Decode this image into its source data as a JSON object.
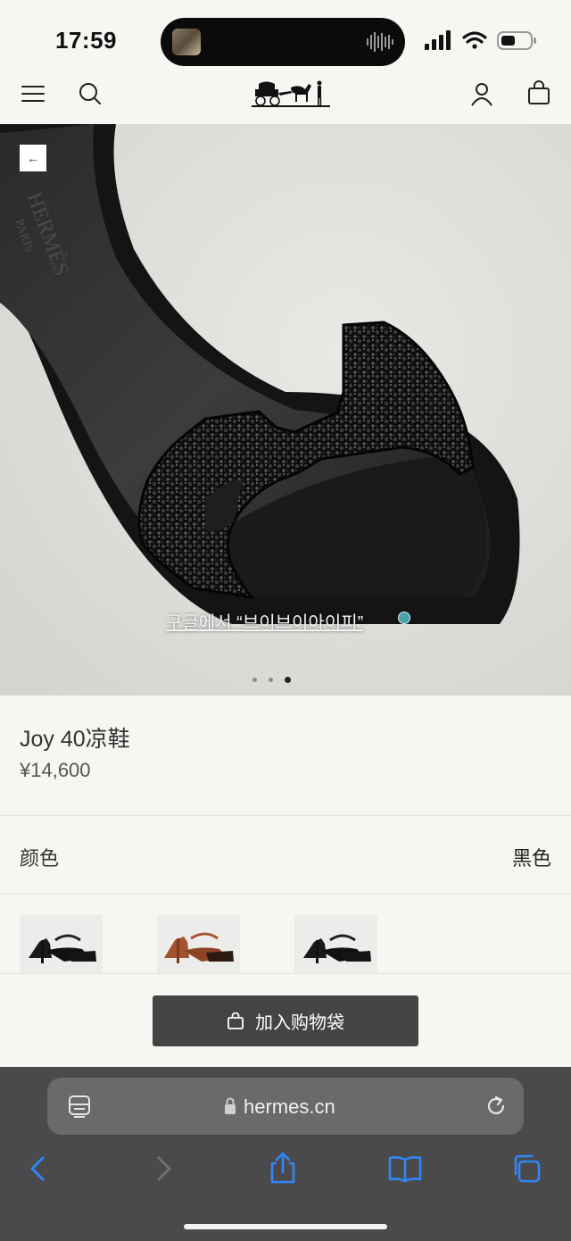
{
  "status": {
    "time": "17:59"
  },
  "hero": {
    "back_glyph": "←",
    "overlay_text": "구글에서 “브이브이아이피”",
    "dots": 3,
    "active_dot": 2
  },
  "product": {
    "title": "Joy 40凉鞋",
    "price": "¥14,600",
    "color_label": "颜色",
    "color_value": "黑色"
  },
  "actions": {
    "add_to_bag": "加入购物袋"
  },
  "browser": {
    "url": "hermes.cn"
  },
  "colors": {
    "accent_ios": "#2f86f6",
    "button_bg": "#444444",
    "page_bg": "#f8f6f2"
  },
  "icons": [
    "menu-icon",
    "search-icon",
    "hermes-logo",
    "account-icon",
    "shopping-bag-icon",
    "back-arrow-icon",
    "reader-icon",
    "lock-icon",
    "reload-icon",
    "back-icon",
    "forward-icon",
    "share-icon",
    "bookmarks-icon",
    "tabs-icon"
  ]
}
